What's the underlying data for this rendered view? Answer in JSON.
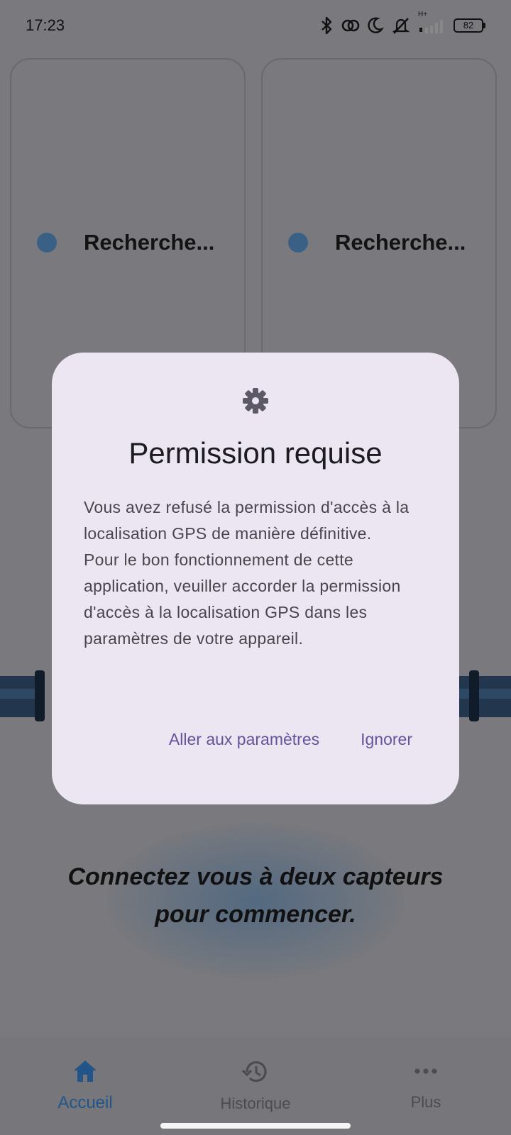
{
  "status_bar": {
    "time": "17:23",
    "network_label": "H+",
    "battery": "82",
    "icons": [
      "bluetooth-icon",
      "sync-icon",
      "moon-icon",
      "silent-icon",
      "signal-icon",
      "battery-icon"
    ]
  },
  "cards": [
    {
      "status": "Recherche..."
    },
    {
      "status": "Recherche..."
    }
  ],
  "main": {
    "instruction": "Connectez vous à deux capteurs pour commencer."
  },
  "dialog": {
    "icon": "gear-icon",
    "title": "Permission requise",
    "body_paragraph_1": "Vous avez refusé la permission d'accès à la localisation GPS de manière définitive.",
    "body_paragraph_2": "Pour le bon fonctionnement de cette application, veuiller accorder la permission d'accès à la localisation GPS dans les paramètres de votre appareil.",
    "settings_button": "Aller aux paramètres",
    "ignore_button": "Ignorer"
  },
  "bottom_nav": {
    "items": [
      {
        "label": "Accueil",
        "icon": "home-icon",
        "active": true
      },
      {
        "label": "Historique",
        "icon": "history-icon",
        "active": false
      },
      {
        "label": "Plus",
        "icon": "more-icon",
        "active": false
      }
    ]
  },
  "colors": {
    "accent": "#21558a",
    "dialog_bg": "#ece6f3",
    "dialog_button": "#62559a",
    "scrim_bg": "#7a797d"
  }
}
